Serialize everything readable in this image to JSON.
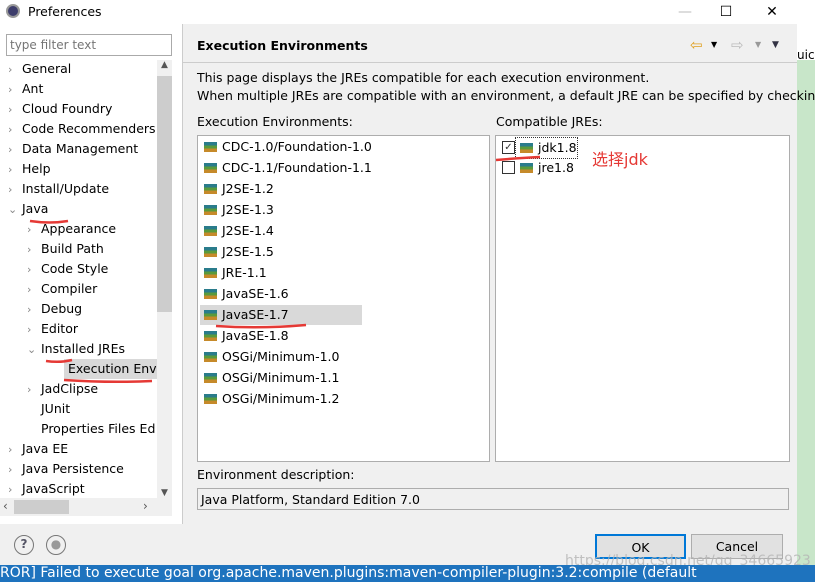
{
  "window": {
    "title": "Preferences",
    "minimize": "—",
    "maximize": "☐",
    "close": "✕"
  },
  "filter": {
    "placeholder": "type filter text"
  },
  "tree": [
    {
      "label": "General",
      "level": 0,
      "chevron": "›"
    },
    {
      "label": "Ant",
      "level": 0,
      "chevron": "›"
    },
    {
      "label": "Cloud Foundry",
      "level": 0,
      "chevron": "›"
    },
    {
      "label": "Code Recommenders",
      "level": 0,
      "chevron": "›"
    },
    {
      "label": "Data Management",
      "level": 0,
      "chevron": "›"
    },
    {
      "label": "Help",
      "level": 0,
      "chevron": "›"
    },
    {
      "label": "Install/Update",
      "level": 0,
      "chevron": "›"
    },
    {
      "label": "Java",
      "level": 0,
      "chevron": "⌄"
    },
    {
      "label": "Appearance",
      "level": 1,
      "chevron": "›"
    },
    {
      "label": "Build Path",
      "level": 1,
      "chevron": "›"
    },
    {
      "label": "Code Style",
      "level": 1,
      "chevron": "›"
    },
    {
      "label": "Compiler",
      "level": 1,
      "chevron": "›"
    },
    {
      "label": "Debug",
      "level": 1,
      "chevron": "›"
    },
    {
      "label": "Editor",
      "level": 1,
      "chevron": "›"
    },
    {
      "label": "Installed JREs",
      "level": 1,
      "chevron": "⌄"
    },
    {
      "label": "Execution Envir",
      "level": 2,
      "chevron": ""
    },
    {
      "label": "JadClipse",
      "level": 1,
      "chevron": "›"
    },
    {
      "label": "JUnit",
      "level": 1,
      "chevron": ""
    },
    {
      "label": "Properties Files Ed",
      "level": 1,
      "chevron": ""
    },
    {
      "label": "Java EE",
      "level": 0,
      "chevron": "›"
    },
    {
      "label": "Java Persistence",
      "level": 0,
      "chevron": "›"
    },
    {
      "label": "JavaScript",
      "level": 0,
      "chevron": "›"
    }
  ],
  "page": {
    "title": "Execution Environments",
    "desc1": "This page displays the JREs compatible for each execution environment.",
    "desc2": "When multiple JREs are compatible with an environment, a default JRE can be specified by checking it.",
    "env_label": "Execution Environments:",
    "jre_label": "Compatible JREs:",
    "environments": [
      "CDC-1.0/Foundation-1.0",
      "CDC-1.1/Foundation-1.1",
      "J2SE-1.2",
      "J2SE-1.3",
      "J2SE-1.4",
      "J2SE-1.5",
      "JRE-1.1",
      "JavaSE-1.6",
      "JavaSE-1.7",
      "JavaSE-1.8",
      "OSGi/Minimum-1.0",
      "OSGi/Minimum-1.1",
      "OSGi/Minimum-1.2"
    ],
    "selected_environment": "JavaSE-1.7",
    "jres": [
      {
        "label": "jdk1.8",
        "checked": true
      },
      {
        "label": "jre1.8",
        "checked": false
      }
    ],
    "envdesc_label": "Environment description:",
    "envdesc_value": "Java Platform, Standard Edition 7.0"
  },
  "annotation": "选择jdk",
  "buttons": {
    "ok": "OK",
    "cancel": "Cancel",
    "help": "?"
  },
  "status_text": "ROR] Failed to execute goal org.apache.maven.plugins:maven-compiler-plugin:3.2:compile (default",
  "watermark": "https://blog.csdn.net/qq_34665923",
  "behind_text": "uick"
}
